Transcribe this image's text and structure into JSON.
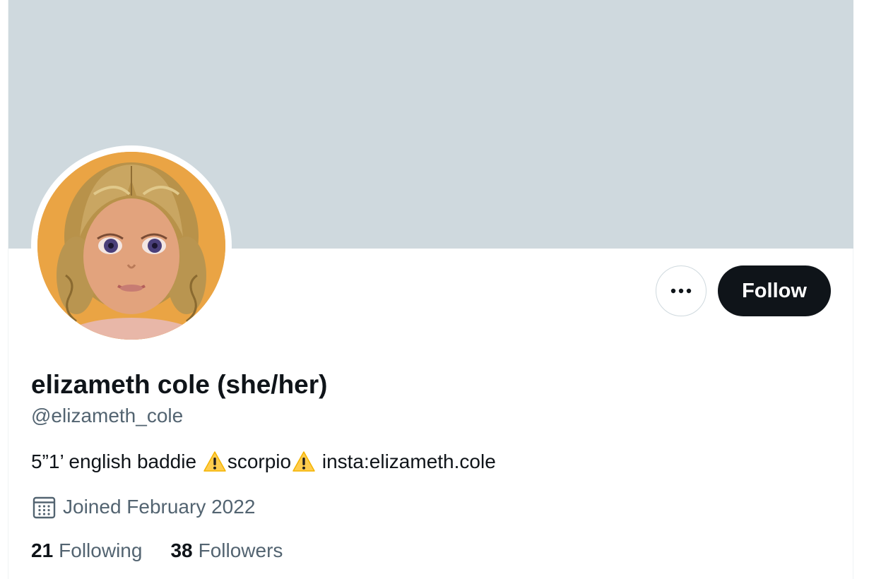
{
  "profile": {
    "display_name": "elizameth cole (she/her)",
    "handle": "@elizameth_cole",
    "bio": {
      "part1": "5”1’ english baddie",
      "emoji1": "warning-emoji",
      "part2": "scorpio",
      "emoji2": "warning-emoji",
      "part3": "insta:elizameth.cole"
    },
    "joined": "Joined February 2022",
    "following_count": "21",
    "following_label": "Following",
    "followers_count": "38",
    "followers_label": "Followers"
  },
  "actions": {
    "more_icon": "more-horizontal-icon",
    "follow_label": "Follow"
  },
  "icons": {
    "joined_icon": "calendar-icon"
  },
  "colors": {
    "banner": "#cfd9de",
    "primary_text": "#0f1419",
    "secondary_text": "#536471",
    "follow_button": "#0f1419",
    "avatar_background": "#eaa444"
  }
}
